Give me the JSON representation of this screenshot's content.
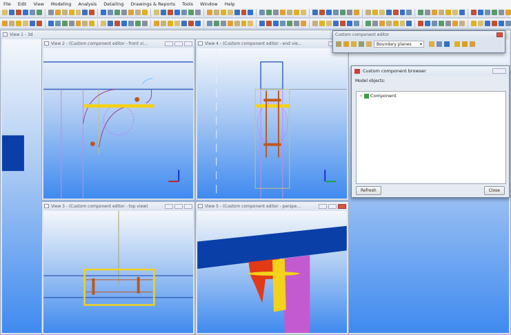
{
  "menu": [
    "File",
    "Edit",
    "View",
    "Modeling",
    "Analysis",
    "Detailing",
    "Drawings & Reports",
    "Tools",
    "Window",
    "Help"
  ],
  "views": {
    "v1": "View 1 - 3d",
    "v2": "View 2 - (Custom component editor - front vi...",
    "v4": "View 4 - (Custom component editor - end vie...",
    "v3": "View 3 - (Custom component editor - top view)",
    "v5": "View 5 - (Custom component editor - perspe..."
  },
  "editor": {
    "title": "Custom component editor",
    "dropdown": "Boundary planes"
  },
  "browser": {
    "title": "Custom component browser",
    "label": "Model objects:",
    "tree": [
      {
        "label": "Component",
        "expander": "+"
      }
    ],
    "refresh": "Refresh",
    "close": "Close"
  },
  "colors": {
    "beam": "#0a3fa8",
    "plate": "#f2d21a",
    "bolt": "#c0561a",
    "column": "#c45ad0",
    "bracket": "#e23a16"
  }
}
